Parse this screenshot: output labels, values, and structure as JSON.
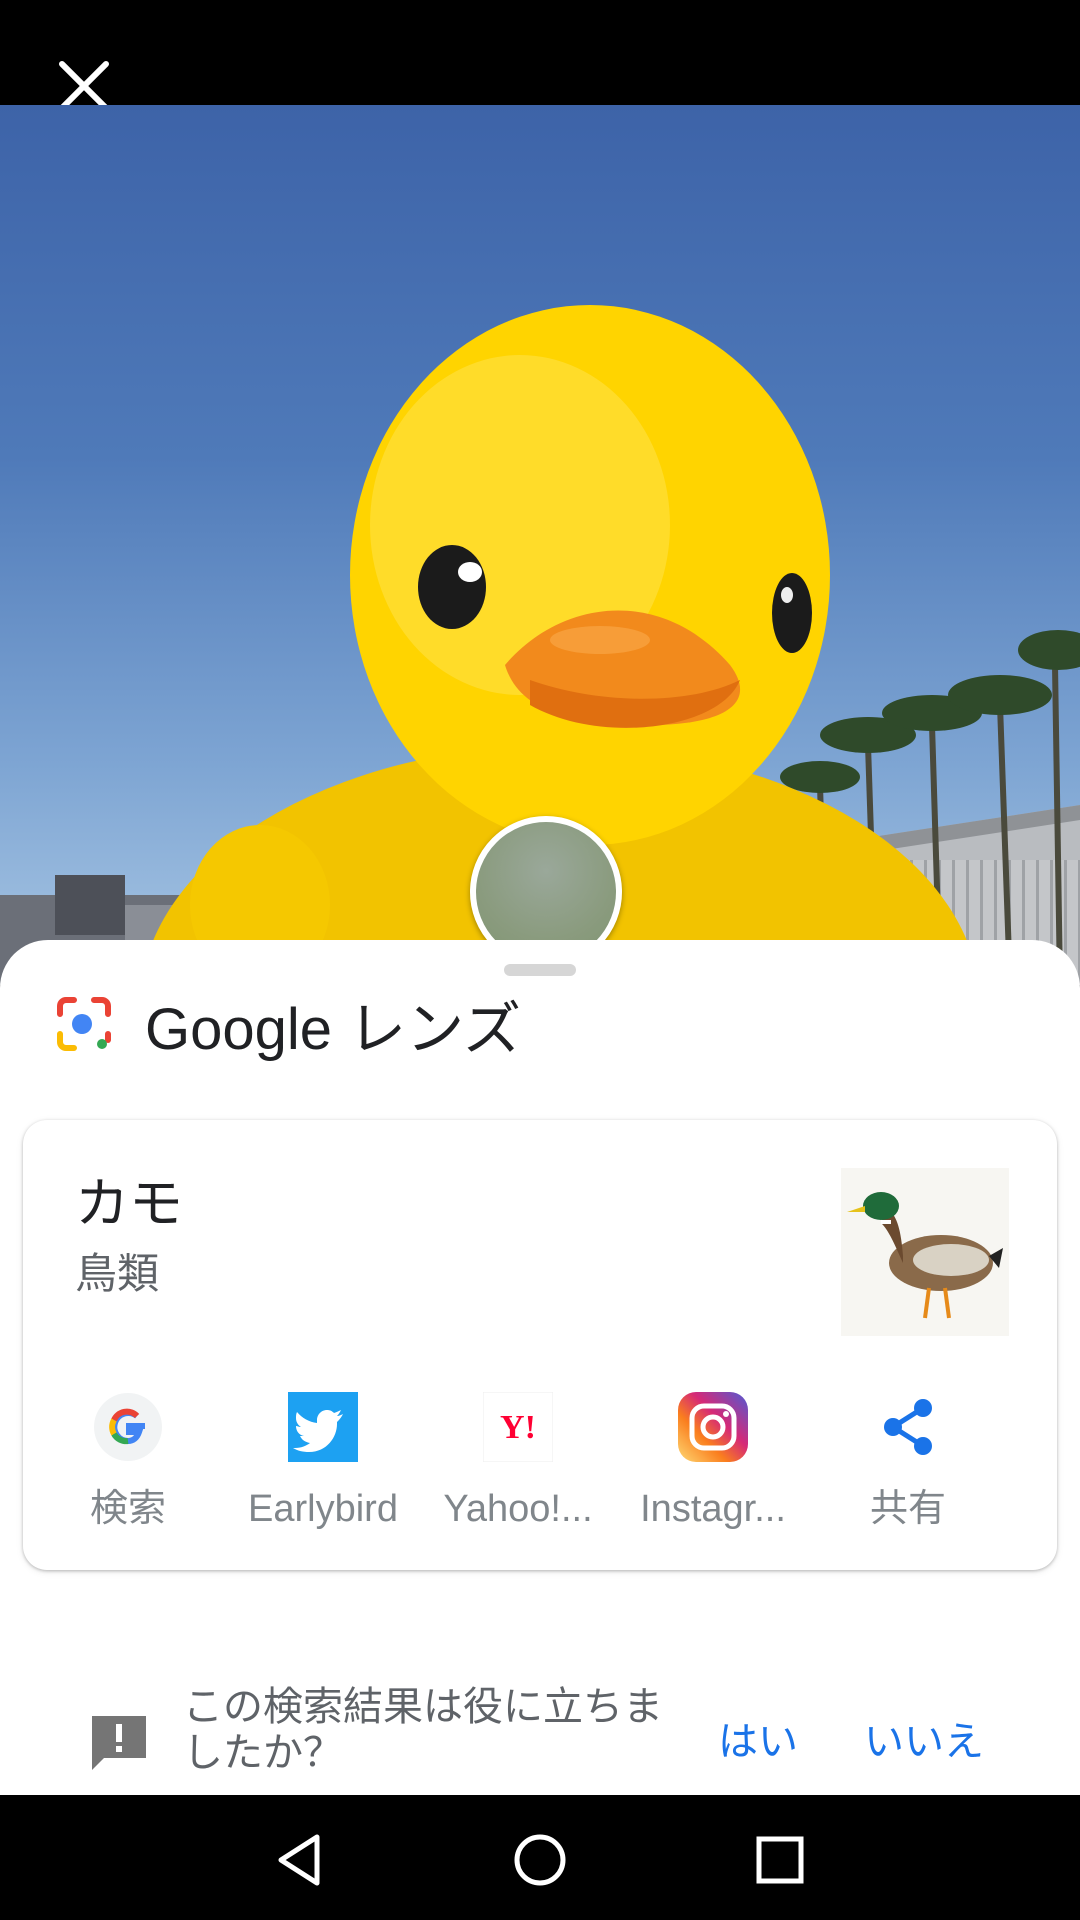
{
  "app": {
    "title_brand": "Google",
    "title_product": "レンズ"
  },
  "result": {
    "title": "カモ",
    "subtitle": "鳥類"
  },
  "actions": [
    {
      "label": "検索",
      "icon": "google-icon"
    },
    {
      "label": "Earlybird",
      "icon": "twitter-bird-icon"
    },
    {
      "label": "Yahoo!...",
      "icon": "yahoo-icon"
    },
    {
      "label": "Instagr...",
      "icon": "instagram-icon"
    },
    {
      "label": "共有",
      "icon": "share-icon"
    }
  ],
  "feedback": {
    "question": "この検索結果は役に立ちましたか？",
    "yes": "はい",
    "no": "いいえ"
  },
  "colors": {
    "accent": "#1a73e8",
    "twitter": "#1da1f2",
    "yahoo_red": "#ff0033",
    "duck_yellow": "#ffd400"
  }
}
